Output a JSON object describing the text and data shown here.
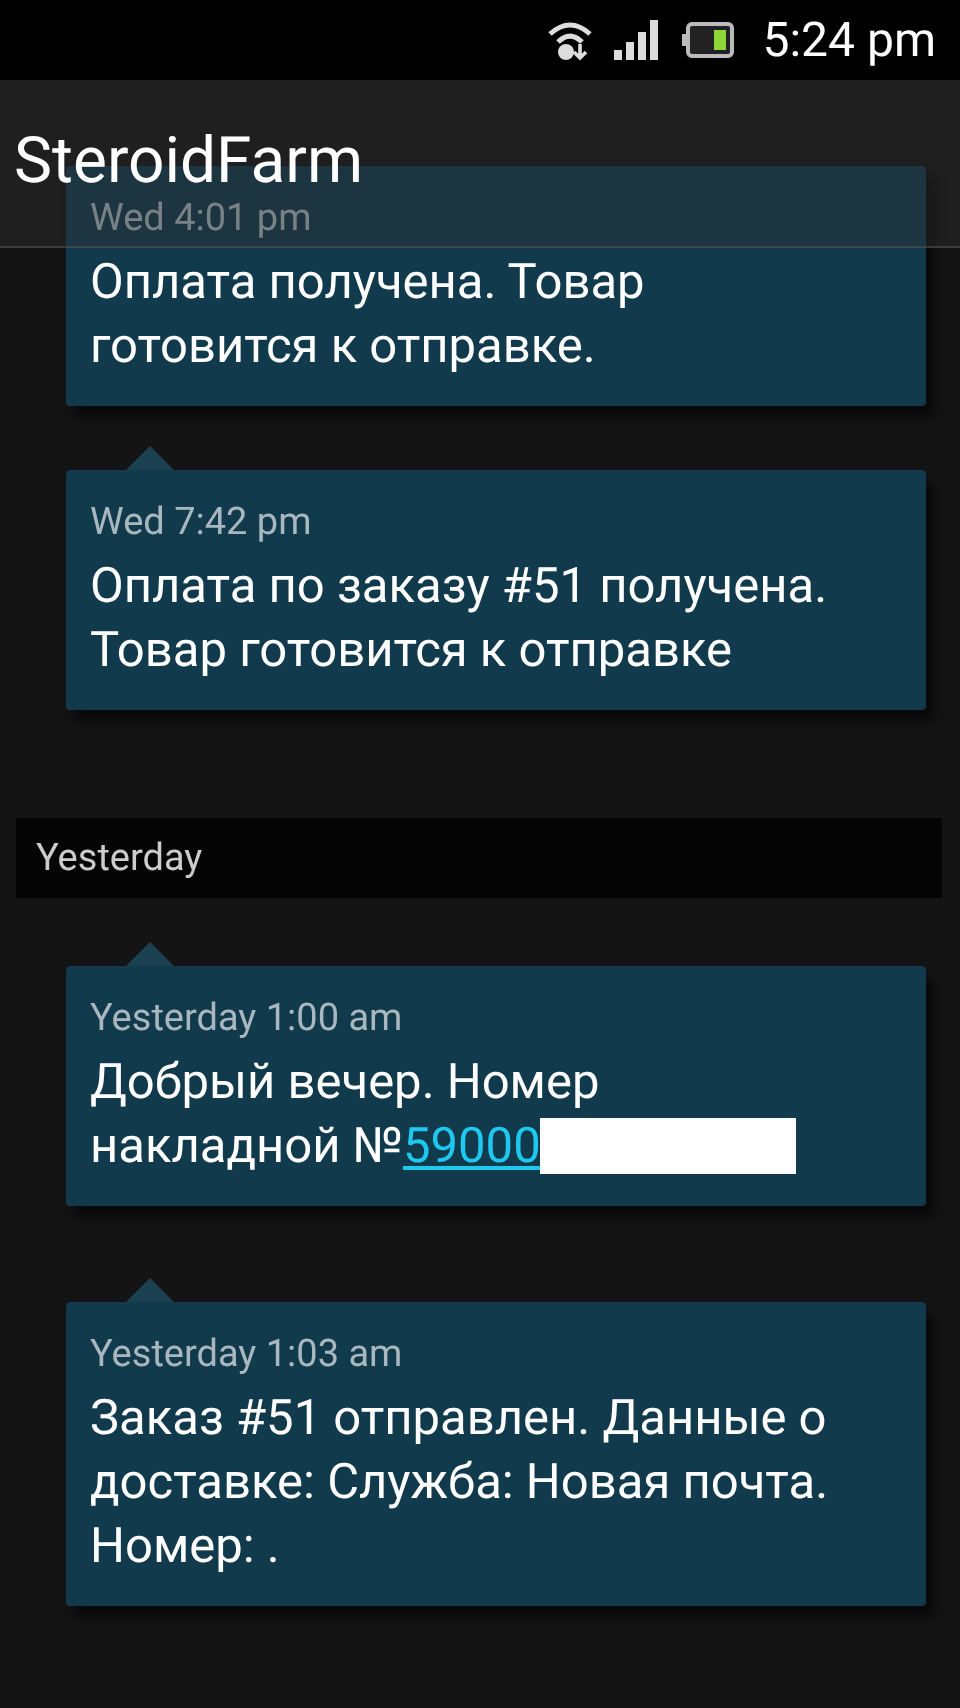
{
  "status_bar": {
    "time": "5:24 pm"
  },
  "app_bar": {
    "title": "SteroidFarm"
  },
  "items": [
    {
      "kind": "message",
      "time": "Wed 4:01 pm",
      "text": "Оплата получена. Товар готовится к отправке."
    },
    {
      "kind": "message",
      "time": "Wed 7:42 pm",
      "text": "Оплата по заказу #51 получена. Товар готовится к отправке"
    },
    {
      "kind": "header",
      "text": "Yesterday"
    },
    {
      "kind": "message",
      "time": "Yesterday 1:00 am",
      "text": "Добрый вечер. Номер накладной №",
      "link": "59000",
      "redacted": true
    },
    {
      "kind": "message",
      "time": "Yesterday 1:03 am",
      "text": "Заказ #51 отправлен. Данные о доставке: Служба: Новая почта. Номер: ."
    }
  ]
}
